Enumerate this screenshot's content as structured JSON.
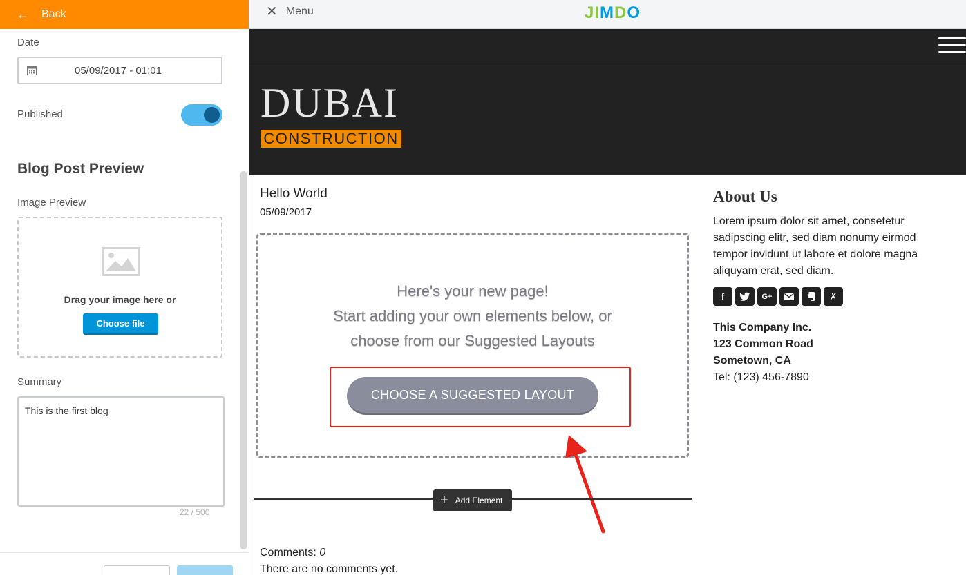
{
  "left_panel": {
    "back_label": "Back",
    "date_label": "Date",
    "date_value": "05/09/2017 - 01:01",
    "published_label": "Published",
    "published": true,
    "preview_title": "Blog Post Preview",
    "image_preview_label": "Image Preview",
    "drag_text": "Drag your image here or",
    "choose_file_label": "Choose file",
    "summary_label": "Summary",
    "summary_value": "This is the first blog",
    "char_count": "22 / 500"
  },
  "topbar": {
    "menu_label": "Menu",
    "logo": "JIMDO"
  },
  "site": {
    "logo_main": "DUBAI",
    "logo_sub": "CONSTRUCTION",
    "post_title": "Hello World",
    "post_date": "05/09/2017",
    "new_page_lines": [
      "Here's your new page!",
      "Start adding your own elements below, or",
      "choose from our Suggested Layouts"
    ],
    "suggest_button": "CHOOSE A SUGGESTED LAYOUT",
    "add_element_label": "Add Element",
    "comments_label": "Comments:",
    "comments_count": "0",
    "no_comments": "There are no comments yet."
  },
  "sidebar": {
    "about_title": "About Us",
    "about_text": "Lorem ipsum dolor sit amet, consetetur sadipscing elitr, sed diam nonumy eirmod tempor invidunt ut labore et dolore magna aliquyam erat, sed diam.",
    "social_icons": [
      "facebook-icon",
      "twitter-icon",
      "google-plus-icon",
      "email-icon",
      "evernote-icon",
      "xing-icon"
    ],
    "company": "This Company Inc.",
    "street": "123 Common Road",
    "city": "Sometown, CA",
    "tel": "Tel: (123) 456-7890"
  },
  "colors": {
    "accent_orange": "#ff8a00",
    "toggle_blue": "#4fb8ee",
    "button_blue": "#0095d9",
    "highlight_red": "#e8231b",
    "header_dark": "#222222"
  }
}
